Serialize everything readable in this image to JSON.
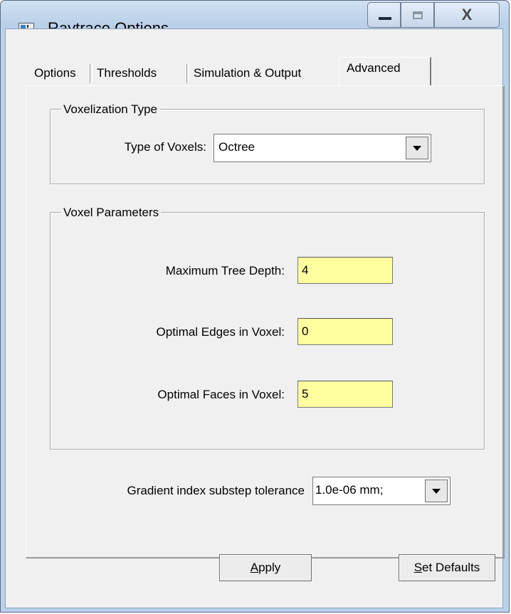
{
  "window": {
    "title": "Raytrace Options",
    "close_glyph": "X"
  },
  "tabs": [
    "Options",
    "Thresholds",
    "Simulation & Output",
    "Advanced"
  ],
  "active_tab": "Advanced",
  "voxelization": {
    "group_title": "Voxelization Type",
    "type_label": "Type of Voxels:",
    "type_value": "Octree"
  },
  "voxel_params": {
    "group_title": "Voxel Parameters",
    "max_depth_label": "Maximum Tree Depth:",
    "max_depth_value": "4",
    "edges_label": "Optimal Edges in Voxel:",
    "edges_value": "0",
    "faces_label": "Optimal Faces in Voxel:",
    "faces_value": "5"
  },
  "gradient": {
    "label": "Gradient index substep tolerance",
    "value": "1.0e-06 mm;"
  },
  "buttons": {
    "apply_mnemonic": "A",
    "apply_rest": "pply",
    "defaults_mnemonic": "S",
    "defaults_rest": "et Defaults"
  },
  "colors": {
    "field_highlight": "#ffffa0",
    "titlebar": "#b9d1ea"
  },
  "icons": [
    "app-window-icon",
    "minimize-icon",
    "maximize-icon",
    "close-icon",
    "chevron-down-icon"
  ]
}
